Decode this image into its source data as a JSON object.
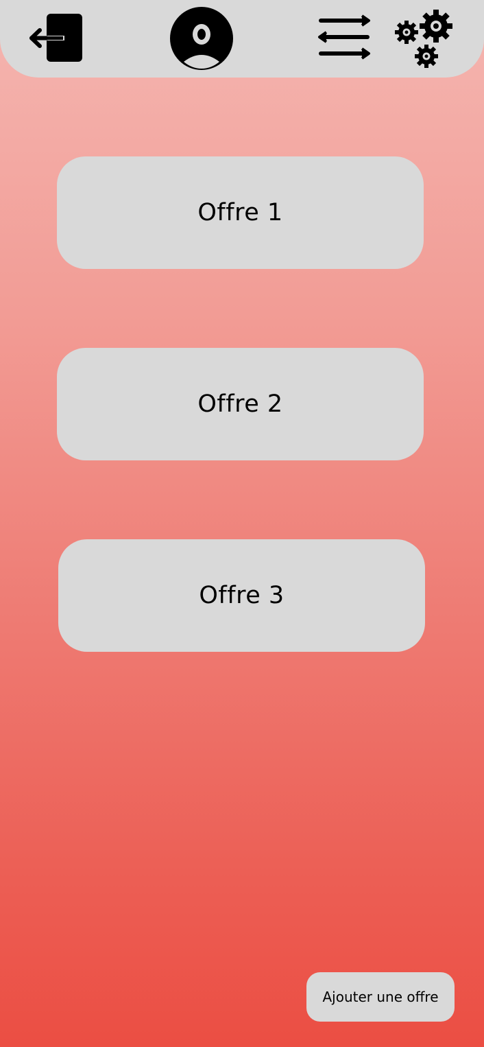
{
  "header": {
    "icons": [
      "logout-icon",
      "profile-icon",
      "transfer-icon",
      "settings-icon"
    ]
  },
  "offers": [
    {
      "label": "Offre 1"
    },
    {
      "label": "Offre 2"
    },
    {
      "label": "Offre 3"
    }
  ],
  "actions": {
    "add_offer_label": "Ajouter une offre"
  },
  "colors": {
    "bar": "#d9d9d9",
    "gradient_top": "#f4b6b1",
    "gradient_bottom": "#eb4e43",
    "icon": "#000000"
  }
}
